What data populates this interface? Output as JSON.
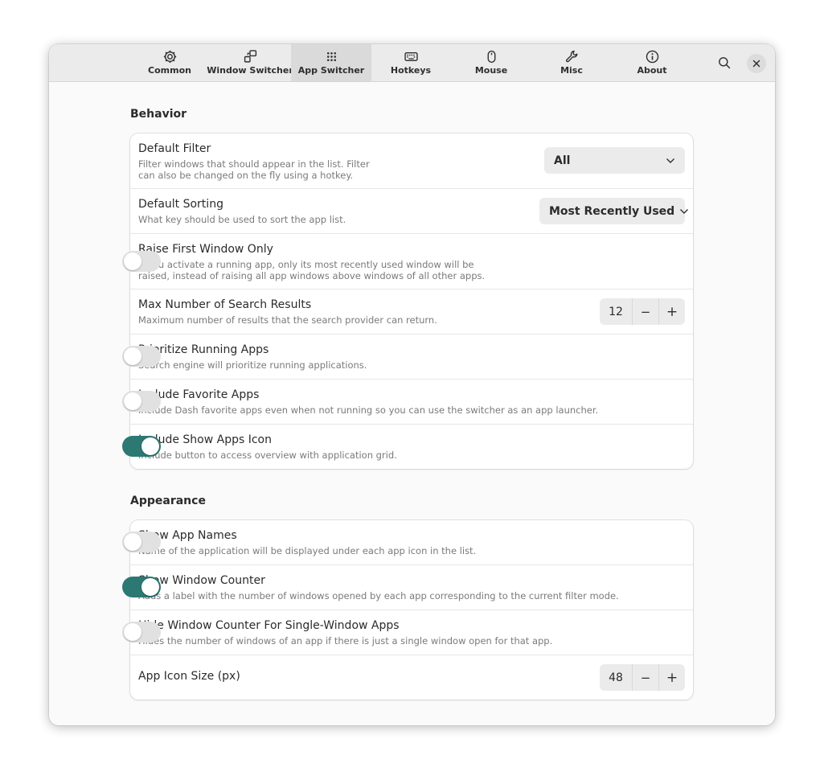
{
  "tabs": [
    {
      "label": "Common",
      "icon": "gear-icon",
      "active": false
    },
    {
      "label": "Window Switcher",
      "icon": "window-switcher-icon",
      "active": false
    },
    {
      "label": "App Switcher",
      "icon": "app-grid-icon",
      "active": true
    },
    {
      "label": "Hotkeys",
      "icon": "keyboard-icon",
      "active": false
    },
    {
      "label": "Mouse",
      "icon": "mouse-icon",
      "active": false
    },
    {
      "label": "Misc",
      "icon": "wrench-icon",
      "active": false
    },
    {
      "label": "About",
      "icon": "info-icon",
      "active": false
    }
  ],
  "header": {
    "search_icon": "search-icon",
    "close_icon": "close-icon"
  },
  "colors": {
    "accent": "#2c7873",
    "switch_off": "#e1e1e1"
  },
  "behavior": {
    "title": "Behavior",
    "rows": {
      "default_filter": {
        "title": "Default Filter",
        "subtitle_1": "Filter windows that should appear in the list. Filter",
        "subtitle_2": "can also be changed on the fly using a hotkey.",
        "value": "All"
      },
      "default_sorting": {
        "title": "Default Sorting",
        "subtitle": "What key should be used to sort the app list.",
        "value": "Most Recently Used"
      },
      "raise_first": {
        "title": "Raise First Window Only",
        "subtitle_1": "If you activate a running app, only its most recently used window will be",
        "subtitle_2": "raised, instead of raising all app windows above windows of all other apps.",
        "on": false
      },
      "max_results": {
        "title": "Max Number of Search Results",
        "subtitle": "Maximum number of results that the search provider can return.",
        "value": "12"
      },
      "prioritize_running": {
        "title": "Prioritize Running Apps",
        "subtitle": "Search engine will prioritize running applications.",
        "on": false
      },
      "include_favorites": {
        "title": "Include Favorite Apps",
        "subtitle": "Include Dash favorite apps even when not running so you can use the switcher as an app launcher.",
        "on": false
      },
      "include_show_apps": {
        "title": "Include Show Apps Icon",
        "subtitle": "Include button to access overview with application grid.",
        "on": true
      }
    }
  },
  "appearance": {
    "title": "Appearance",
    "rows": {
      "show_app_names": {
        "title": "Show App Names",
        "subtitle": "Name of the application will be displayed under each app icon in the list.",
        "on": false
      },
      "show_window_counter": {
        "title": "Show Window Counter",
        "subtitle": "Adds a label with the number of windows opened by each app corresponding to the current filter mode.",
        "on": true
      },
      "hide_window_counter": {
        "title": "Hide Window Counter For Single-Window Apps",
        "subtitle": "Hides the number of windows of an app if there is just a single window open for that app.",
        "on": false
      },
      "icon_size": {
        "title": "App Icon Size (px)",
        "value": "48"
      }
    }
  },
  "spin_labels": {
    "minus": "−",
    "plus": "+"
  }
}
